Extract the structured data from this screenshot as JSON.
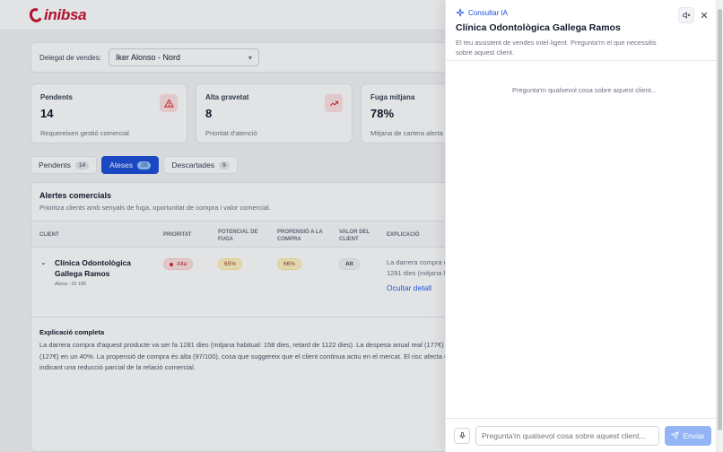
{
  "brand": {
    "name": "inibsa",
    "color": "#c8102e"
  },
  "filter": {
    "label": "Delegat de vendes:",
    "selected": "Iker Alonso - Nord"
  },
  "kpis": [
    {
      "title": "Pendents",
      "value": "14",
      "sub": "Requereixen gestió comercial",
      "icon": "warning-triangle-icon"
    },
    {
      "title": "Alta gravetat",
      "value": "8",
      "sub": "Prioritat d'atenció",
      "icon": "trending-up-icon"
    },
    {
      "title": "Fuga mitjana",
      "value": "78%",
      "sub": "Mitjana de cartera alerta"
    }
  ],
  "tabs": [
    {
      "label": "Pendents",
      "count": "14"
    },
    {
      "label": "Ateses",
      "count": "20"
    },
    {
      "label": "Descartades",
      "count": "9"
    }
  ],
  "table": {
    "title": "Alertes comercials",
    "subtitle": "Prioritza clients amb senyals de fuga, oportunitat de compra i valor comercial.",
    "headers": [
      "Client",
      "Prioritat",
      "Potencial de fuga",
      "Propensió a la compra",
      "Valor del client",
      "Explicació"
    ],
    "row": {
      "client_line1": "Clínica Odontològica",
      "client_line2": "Gallega Ramos",
      "meta": "Atesa · ID 185",
      "priority": "Alta",
      "fuga": "65%",
      "propensio": "66%",
      "valor": "Alt",
      "expl_line1": "La darrera compra d",
      "expl_line2": "1281 dies (mitjana h",
      "link": "Ocultar detall"
    },
    "full_title": "Explicació completa",
    "full_lines": [
      "La darrera compra d'aquest producte va ser fa 1281 dies (mitjana habitual: 158 dies, retard de 1122 dies). La despesa anual real (177€) super",
      "(127€) en un 40%. La propensió de compra és alta (97/100), cosa que suggereix que el client continua actiu en el mercat. El risc afecta divers",
      "indicant una reducció parcial de la relació comercial."
    ]
  },
  "panel": {
    "kicker": "Consultar IA",
    "title": "Clínica Odontològica Gallega Ramos",
    "desc": "El teu assistent de vendes intel·ligent. Pregunta'm el que necessitis sobre aquest client.",
    "empty": "Pregunta'm qualsevol cosa sobre aquest client...",
    "input_placeholder": "Pregunta'm qualsevol cosa sobre aquest client...",
    "send_label": "Enviar"
  }
}
